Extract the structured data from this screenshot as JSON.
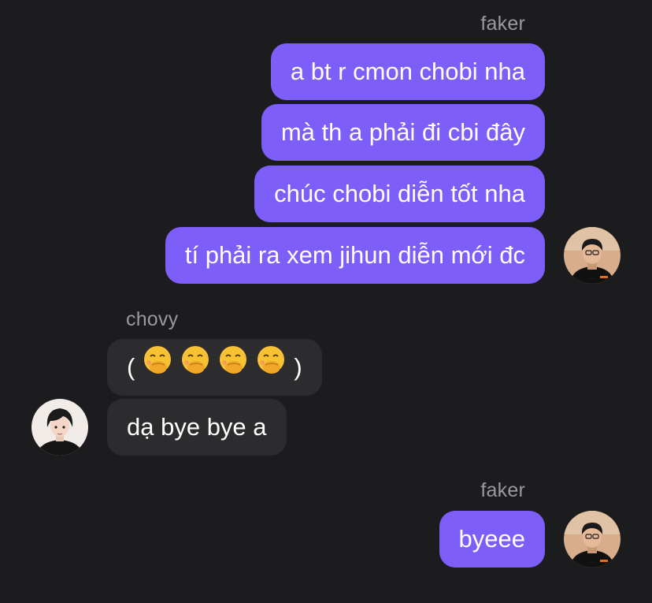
{
  "colors": {
    "background": "#1c1c1e",
    "outgoing_bubble": "#7d5ef8",
    "incoming_bubble": "#2c2c2e",
    "sender_name": "#9a9a9e"
  },
  "conversation": {
    "groups": [
      {
        "sender": "faker",
        "direction": "outgoing",
        "messages": [
          "a bt r cmon chobi nha",
          "mà th a phải đi cbi đây",
          "chúc chobi diễn tốt nha",
          "tí phải ra xem jihun diễn mới đc"
        ]
      },
      {
        "sender": "chovy",
        "direction": "incoming",
        "emoji_message": {
          "open": "(",
          "close": ")",
          "emojis": [
            "🤭",
            "🤭",
            "🤭",
            "🤭"
          ],
          "icon": "face-with-hand-over-mouth-icon"
        },
        "messages": [
          "dạ bye bye a"
        ]
      },
      {
        "sender": "faker",
        "direction": "outgoing",
        "messages": [
          "byeee"
        ]
      }
    ]
  }
}
